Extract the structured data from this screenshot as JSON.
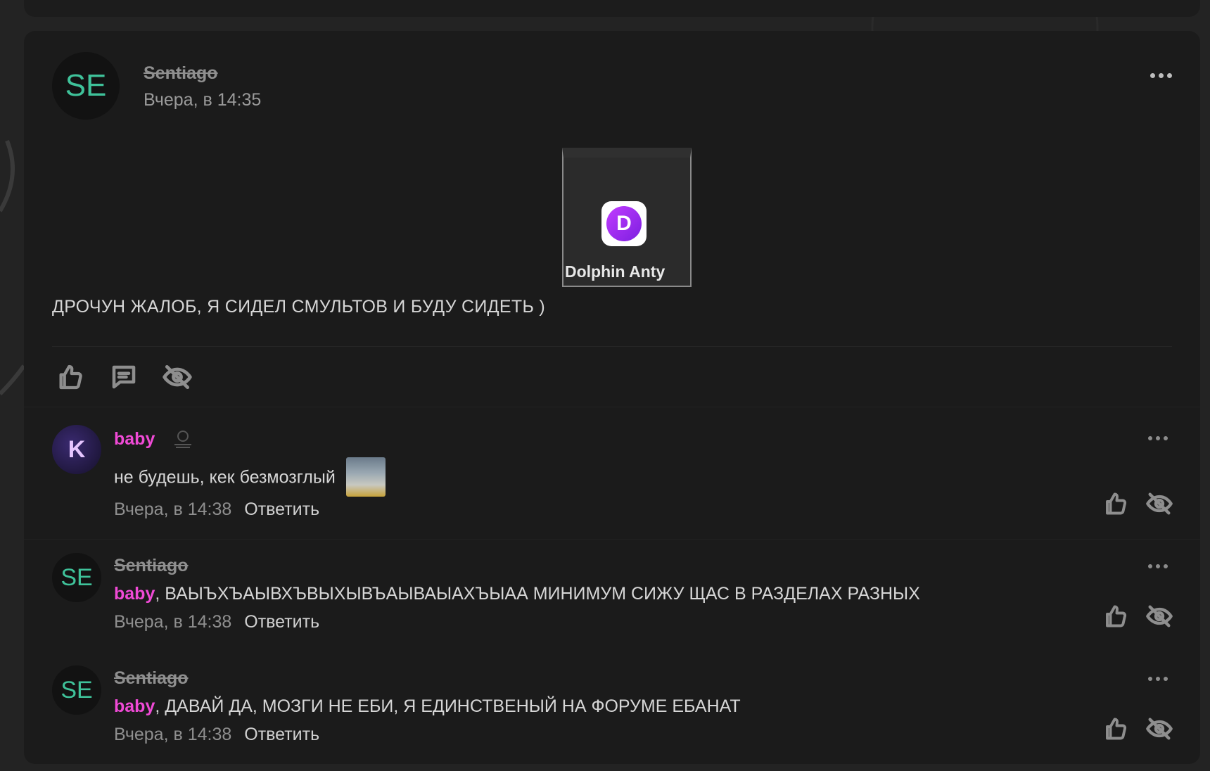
{
  "post": {
    "author": "Sentiago",
    "avatar_initials": "SE",
    "time": "Вчера, в 14:35",
    "attachment_label": "Dolphin Anty",
    "attachment_icon_letter": "D",
    "text": "ДРОЧУН ЖАЛОБ, Я СИДЕЛ СМУЛЬТОВ И БУДУ СИДЕТЬ )"
  },
  "actions": {
    "like_icon": "thumbs-up-icon",
    "comment_icon": "comment-icon",
    "hide_icon": "eye-off-icon"
  },
  "comments": [
    {
      "author": "baby",
      "avatar_initials": "K",
      "text": "не будешь, кек безмозглый",
      "time": "Вчера, в 14:38",
      "reply_label": "Ответить"
    },
    {
      "author": "Sentiago",
      "avatar_initials": "SE",
      "mention": "baby",
      "text": ", ВАЫЪХЪАЫВХЪВЫХЫВЪАЫВАЫАХЪЫАА МИНИМУМ СИЖУ ЩАС В РАЗДЕЛАХ РАЗНЫХ",
      "time": "Вчера, в 14:38",
      "reply_label": "Ответить"
    },
    {
      "author": "Sentiago",
      "avatar_initials": "SE",
      "mention": "baby",
      "text": ", ДАВАЙ ДА, МОЗГИ НЕ ЕБИ, Я ЕДИНСТВЕНЫЙ НА ФОРУМЕ ЕБАНАТ",
      "time": "Вчера, в 14:38",
      "reply_label": "Ответить"
    }
  ],
  "colors": {
    "accent_mention": "#f04ad6",
    "avatar_initials": "#3fc29a",
    "app_icon": "#9b2ff0"
  }
}
